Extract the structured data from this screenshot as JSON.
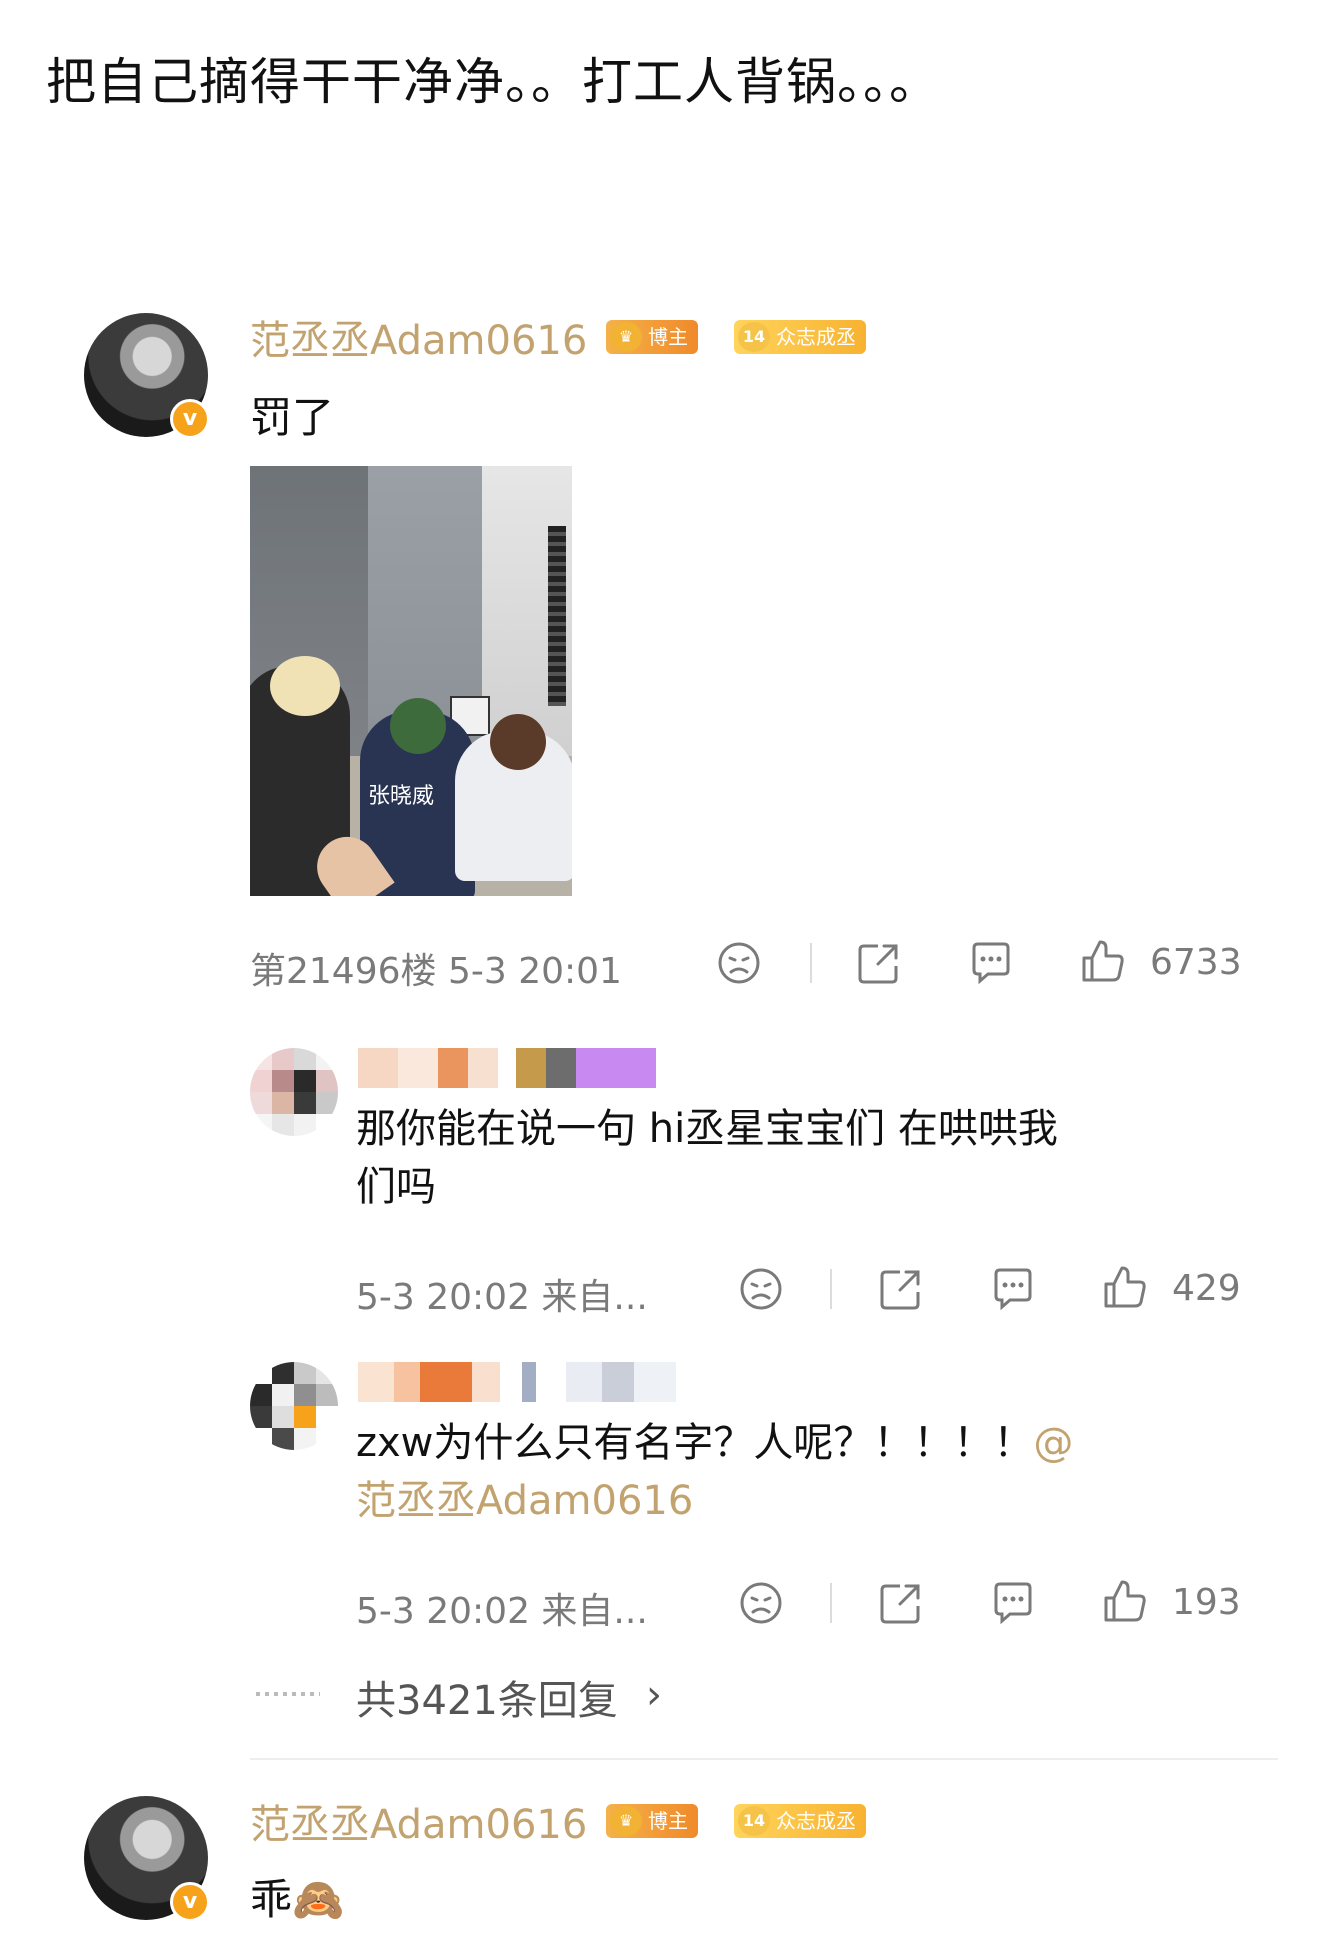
{
  "post": {
    "caption": "把自己摘得干干净净。。打工人背锅。。。"
  },
  "colors": {
    "username": "#c2a26e",
    "meta": "#7a7a7a",
    "blogger_badge": "#f08a2a",
    "fan_badge": "#f8b230",
    "verified": "#f7a21b"
  },
  "comment1": {
    "username": "范丞丞Adam0616",
    "badge_blogger": "博主",
    "badge_fan_level": "14",
    "badge_fan": "众志成丞",
    "verified_mark": "v",
    "text": "罚了",
    "image_label": "张晓威",
    "floor_meta": "第21496楼 5-3 20:01",
    "likes": "6733"
  },
  "reply1": {
    "text": "那你能在说一句 hi丞星宝宝们 在哄哄我们吗",
    "meta": "5-3 20:02 来自...",
    "likes": "429"
  },
  "reply2": {
    "text": "zxw为什么只有名字？人呢？！！！！",
    "mention": "@范丞丞Adam0616",
    "meta": "5-3 20:02 来自...",
    "likes": "193"
  },
  "more_replies": {
    "label": "共3421条回复",
    "chevron": "›"
  },
  "comment2": {
    "username": "范丞丞Adam0616",
    "badge_blogger": "博主",
    "badge_fan_level": "14",
    "badge_fan": "众志成丞",
    "verified_mark": "v",
    "text": "乖",
    "emoji": "🙈"
  },
  "icons": [
    "sad-face-icon",
    "share-icon",
    "comment-icon",
    "thumbs-up-icon"
  ]
}
